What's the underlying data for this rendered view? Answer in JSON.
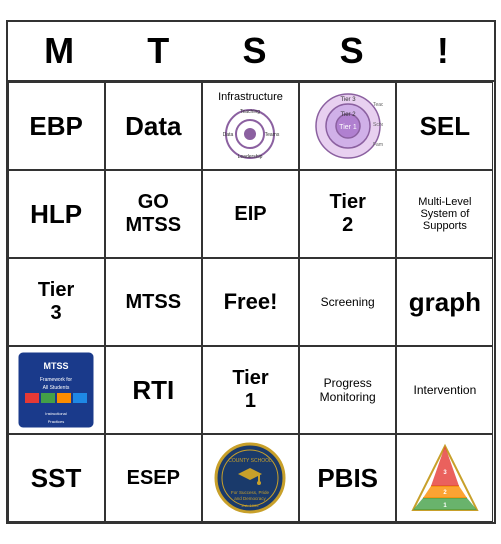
{
  "title": {
    "letters": [
      "M",
      "T",
      "S",
      "S",
      "!"
    ]
  },
  "grid": [
    [
      {
        "id": "r0c0",
        "type": "text-large",
        "text": "EBP"
      },
      {
        "id": "r0c1",
        "type": "text-large",
        "text": "Data"
      },
      {
        "id": "r0c2",
        "type": "infra",
        "text": "Infrastructure"
      },
      {
        "id": "r0c3",
        "type": "tier-diagram",
        "text": ""
      },
      {
        "id": "r0c4",
        "type": "text-large",
        "text": "SEL"
      }
    ],
    [
      {
        "id": "r1c0",
        "type": "text-large",
        "text": "HLP"
      },
      {
        "id": "r1c1",
        "type": "text-medium",
        "text": "GO\nMTSS"
      },
      {
        "id": "r1c2",
        "type": "text-medium",
        "text": "EIP"
      },
      {
        "id": "r1c3",
        "type": "text-medium",
        "text": "Tier\n2"
      },
      {
        "id": "r1c4",
        "type": "text-small",
        "text": "Multi-Level System of Supports"
      }
    ],
    [
      {
        "id": "r2c0",
        "type": "text-medium",
        "text": "Tier\n3"
      },
      {
        "id": "r2c1",
        "type": "text-medium",
        "text": "MTSS"
      },
      {
        "id": "r2c2",
        "type": "text-large-free",
        "text": "Free!"
      },
      {
        "id": "r2c3",
        "type": "text-medium",
        "text": "Screening"
      },
      {
        "id": "r2c4",
        "type": "text-large",
        "text": "graph"
      }
    ],
    [
      {
        "id": "r3c0",
        "type": "mtss-logo",
        "text": ""
      },
      {
        "id": "r3c1",
        "type": "text-large",
        "text": "RTI"
      },
      {
        "id": "r3c2",
        "type": "text-medium",
        "text": "Tier\n1"
      },
      {
        "id": "r3c3",
        "type": "text-small",
        "text": "Progress Monitoring"
      },
      {
        "id": "r3c4",
        "type": "text-medium",
        "text": "Intervention"
      }
    ],
    [
      {
        "id": "r4c0",
        "type": "text-large",
        "text": "SST"
      },
      {
        "id": "r4c1",
        "type": "text-medium",
        "text": "ESEP"
      },
      {
        "id": "r4c2",
        "type": "school-seal",
        "text": ""
      },
      {
        "id": "r4c3",
        "type": "text-large",
        "text": "PBIS"
      },
      {
        "id": "r4c4",
        "type": "pbis-pyramid",
        "text": ""
      }
    ]
  ]
}
